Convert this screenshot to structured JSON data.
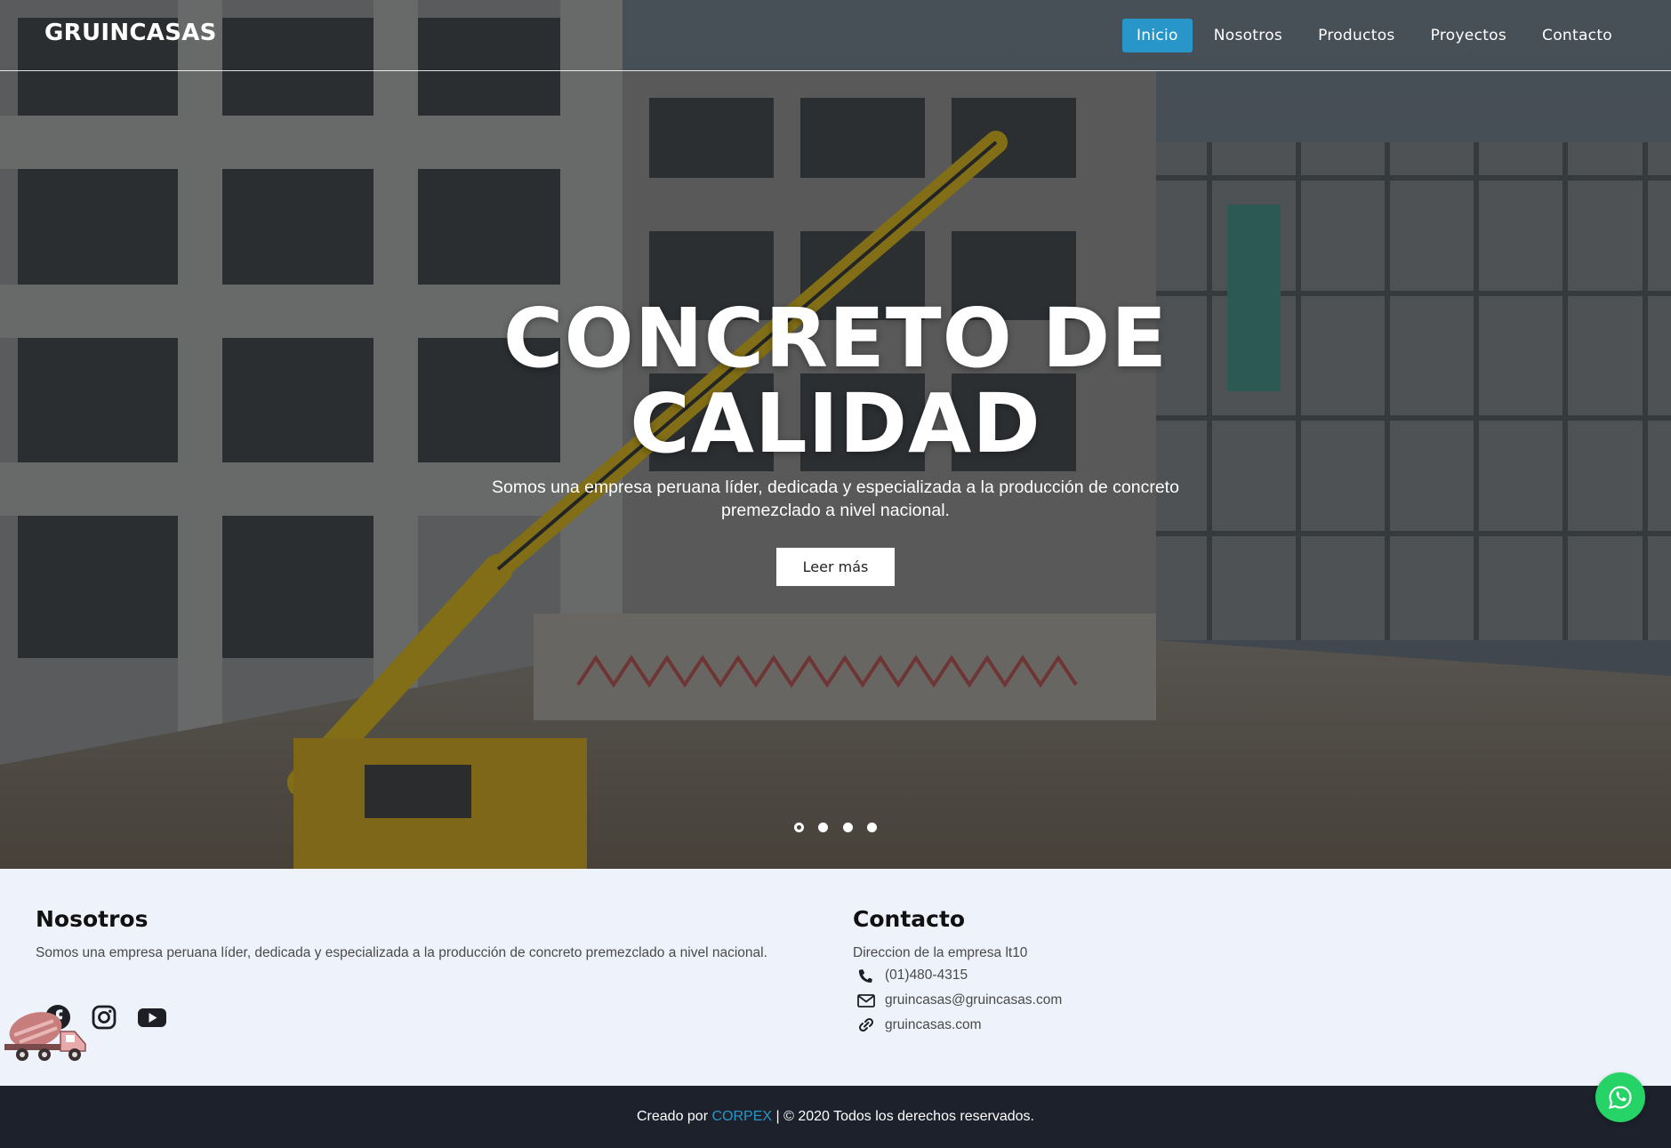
{
  "navbar": {
    "brand": "GRUINCASAS",
    "items": [
      {
        "label": "Inicio",
        "active": true
      },
      {
        "label": "Nosotros",
        "active": false
      },
      {
        "label": "Productos",
        "active": false
      },
      {
        "label": "Proyectos",
        "active": false
      },
      {
        "label": "Contacto",
        "active": false
      }
    ]
  },
  "hero": {
    "title": "CONCRETO DE CALIDAD",
    "subtitle": "Somos una empresa peruana líder, dedicada y especializada a la producción de concreto premezclado a nivel nacional.",
    "button_label": "Leer más",
    "slides_count": 4,
    "active_slide": 1
  },
  "about": {
    "heading": "Nosotros",
    "text": "Somos una empresa peruana líder, dedicada y especializada a la producción de concreto premezclado a nivel nacional.",
    "social": [
      "facebook-icon",
      "instagram-icon",
      "youtube-icon"
    ]
  },
  "contact": {
    "heading": "Contacto",
    "address": "Direccion de la empresa lt10",
    "phone": "(01)480-4315",
    "email": "gruincasas@gruincasas.com",
    "website": "gruincasas.com"
  },
  "footer": {
    "prefix": "Creado por",
    "brand": "CORPEX",
    "suffix": "| © 2020 Todos los derechos reservados."
  },
  "colors": {
    "accent": "#2896c8",
    "footer_bg": "#1d212c",
    "info_bg": "#eef2fb",
    "whatsapp": "#25d366"
  }
}
